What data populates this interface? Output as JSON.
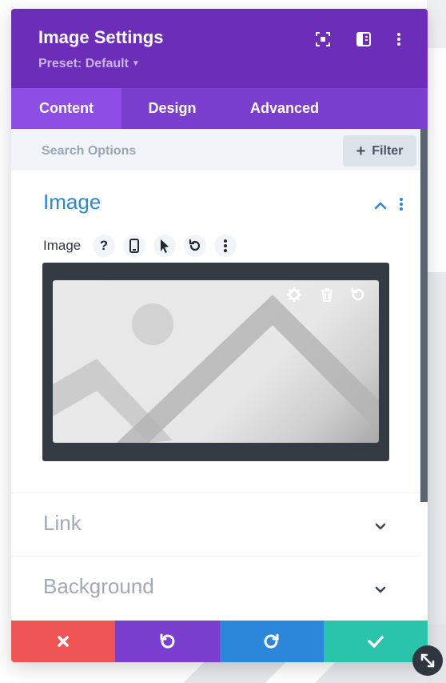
{
  "header": {
    "title": "Image Settings",
    "preset": "Preset: Default",
    "bg_color": "#6c2eb9",
    "icons": [
      "focus-icon",
      "sidebar-layout-icon",
      "more-options-icon"
    ]
  },
  "tabs": [
    {
      "label": "Content",
      "active": true
    },
    {
      "label": "Design",
      "active": false
    },
    {
      "label": "Advanced",
      "active": false
    }
  ],
  "search": {
    "placeholder": "Search Options",
    "filter_label": "Filter"
  },
  "sections": {
    "image": {
      "title": "Image",
      "expanded": true,
      "field_label": "Image",
      "field_icons": [
        "help-icon",
        "mobile-icon",
        "pointer-icon",
        "reset-icon",
        "more-icon"
      ],
      "upload_icons": [
        "gear-icon",
        "trash-icon",
        "reset-icon"
      ]
    },
    "link": {
      "title": "Link",
      "expanded": false
    },
    "background": {
      "title": "Background",
      "expanded": false
    }
  },
  "footer": {
    "buttons": [
      {
        "name": "discard",
        "icon": "close-icon",
        "color": "#ef5555"
      },
      {
        "name": "undo",
        "icon": "undo-icon",
        "color": "#7b3fcf"
      },
      {
        "name": "redo",
        "icon": "redo-icon",
        "color": "#2b87da"
      },
      {
        "name": "save",
        "icon": "check-icon",
        "color": "#29c4a9"
      }
    ]
  },
  "colors": {
    "accent": "#2b87da",
    "tab_active": "#8d4ee6",
    "tab_bar": "#7b3fcf"
  }
}
